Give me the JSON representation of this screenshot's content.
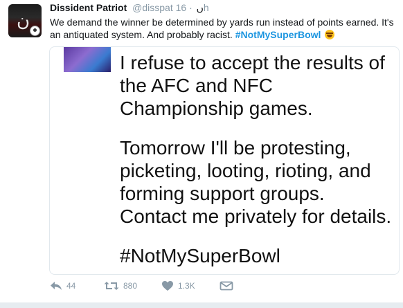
{
  "tweet": {
    "author_name": "Dissident Patriot",
    "handle": "@disspat",
    "name_glyph": "ں",
    "separator": "·",
    "time": "16h",
    "text_plain": "We demand the winner be determined by yards run instead of points earned. It's an antiquated system. And probably racist. ",
    "hashtag": "#NotMySuperBowl",
    "emoji_icon": "face-with-tears-of-joy-icon",
    "media_lines": [
      "I refuse to accept the results of",
      "the AFC and NFC",
      "Championship games.",
      "Tomorrow I'll be protesting,",
      "picketing, looting, rioting, and",
      "forming support groups.",
      "Contact me privately for details.",
      "#NotMySuperBowl"
    ],
    "reply_count": "44",
    "retweet_count": "880",
    "like_count": "1.3K"
  },
  "colors": {
    "link": "#1b95e0",
    "muted": "#8899a6",
    "text": "#14171a",
    "divider": "#e6ecf0"
  }
}
